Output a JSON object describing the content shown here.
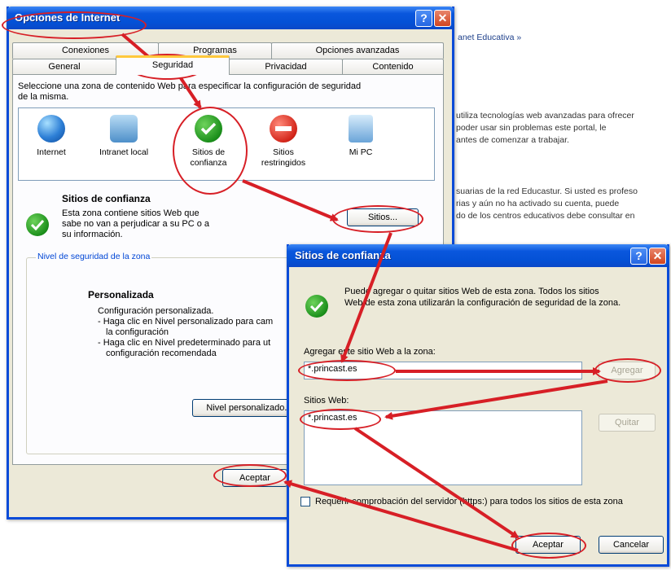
{
  "background_page": {
    "breadcrumb": "anet Educativa »",
    "para1": [
      "utiliza tecnologías web avanzadas para ofrecer",
      "poder usar sin problemas este portal, le",
      "antes de comenzar a trabajar."
    ],
    "para2": [
      "suarias de la red Educastur. Si usted es profeso",
      "rias y aún no ha activado su cuenta, puede",
      "do de los centros educativos debe consultar en"
    ]
  },
  "internet_options": {
    "title": "Opciones de Internet",
    "help_glyph": "?",
    "close_glyph": "✕",
    "tabs_back": [
      "Conexiones",
      "Programas",
      "Opciones avanzadas"
    ],
    "tabs_front": [
      "General",
      "Seguridad",
      "Privacidad",
      "Contenido"
    ],
    "active_tab": "Seguridad",
    "instruction": [
      "Seleccione una zona de contenido Web para especificar la configuración de seguridad",
      "de la misma."
    ],
    "zones": [
      {
        "label": "Internet",
        "icon": "globe-icon"
      },
      {
        "label": "Intranet local",
        "icon": "network-globe-icon"
      },
      {
        "label": "Sitios de confianza",
        "icon": "check-icon"
      },
      {
        "label": "Sitios restringidos",
        "icon": "no-entry-icon"
      },
      {
        "label": "Mi PC",
        "icon": "computer-icon"
      }
    ],
    "zone_heading": "Sitios de confianza",
    "zone_desc": [
      "Esta zona contiene sitios Web que",
      "sabe no van a perjudicar a su PC o a",
      "su información."
    ],
    "sitios_button": "Sitios...",
    "level_group": "Nivel de seguridad de la zona",
    "level_title": "Personalizada",
    "level_lines": [
      "Configuración personalizada.",
      "- Haga clic en Nivel personalizado para cam",
      "la configuración",
      "- Haga clic en Nivel predeterminado para ut",
      "configuración recomendada"
    ],
    "custom_level_button": "Nivel personalizado...",
    "ok_button": "Aceptar"
  },
  "trusted_sites": {
    "title": "Sitios de confianza",
    "help_glyph": "?",
    "close_glyph": "✕",
    "info": [
      "Puede agregar o quitar sitios Web de esta zona.  Todos los sitios",
      "Web de esta zona utilizarán la configuración de seguridad de la zona."
    ],
    "add_label": "Agregar este sitio Web a la zona:",
    "add_value": "*.princast.es",
    "add_button": "Agregar",
    "sites_label": "Sitios Web:",
    "sites": [
      "*.princast.es"
    ],
    "remove_button": "Quitar",
    "require_https": "Requerir comprobación del servidor (https:) para todos los sitios de esta zona",
    "ok_button": "Aceptar",
    "cancel_button": "Cancelar"
  },
  "colors": {
    "annotation": "#d71f26",
    "titlebar": "#0451d6",
    "face": "#ece9d8"
  }
}
